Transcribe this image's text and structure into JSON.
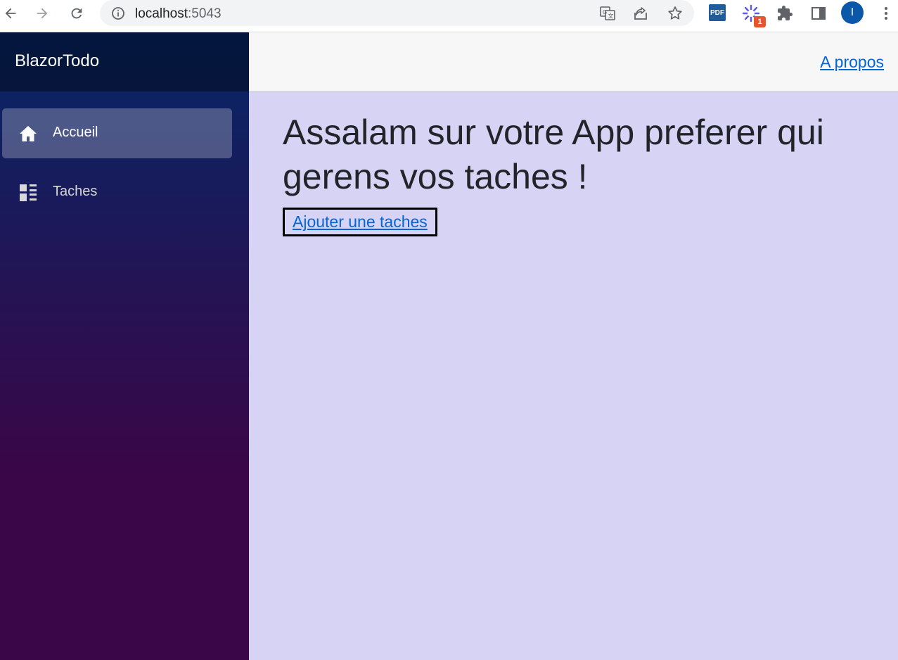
{
  "browser": {
    "url_host": "localhost",
    "url_port": ":5043",
    "pdf_ext_label": "PDF",
    "ext_badge": "1",
    "avatar_letter": "I"
  },
  "sidebar": {
    "brand": "BlazorTodo",
    "items": [
      {
        "label": "Accueil",
        "icon": "home-icon",
        "active": true
      },
      {
        "label": "Taches",
        "icon": "list-icon",
        "active": false
      }
    ]
  },
  "top_row": {
    "about_link": "A propos"
  },
  "main": {
    "heading": "Assalam sur votre App preferer qui gerens vos taches !",
    "add_link": "Ajouter une taches"
  },
  "colors": {
    "content_bg": "#d6d3f4",
    "link": "#0366d6",
    "sidebar_top": "#052767",
    "sidebar_bottom": "#3a0647"
  }
}
